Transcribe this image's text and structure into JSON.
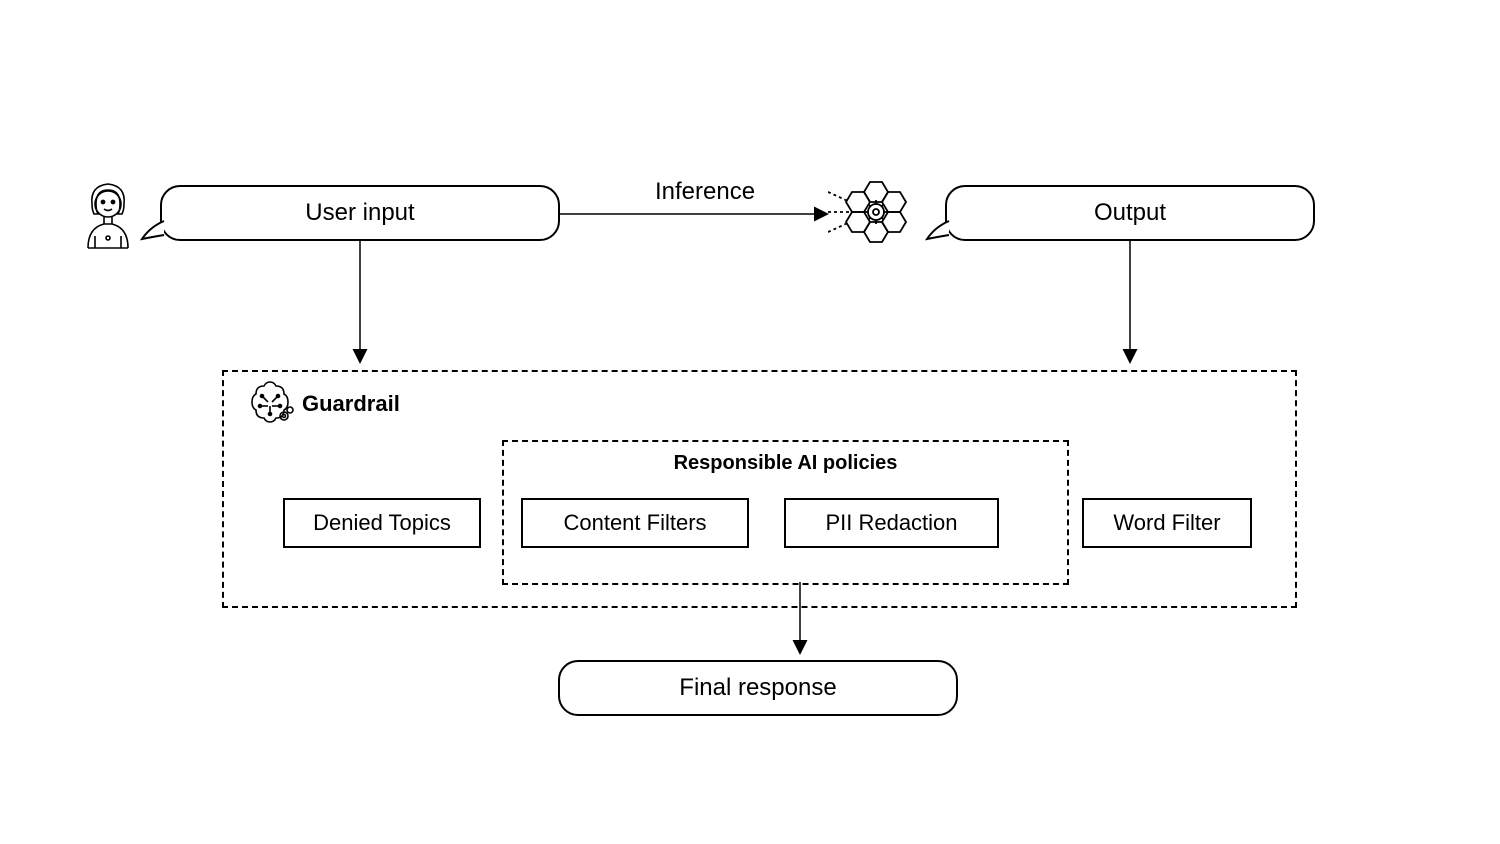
{
  "diagram": {
    "user_input_label": "User input",
    "inference_label": "Inference",
    "output_label": "Output",
    "guardrail_title": "Guardrail",
    "policies_title": "Responsible AI policies",
    "filters": {
      "denied_topics": "Denied Topics",
      "content_filters": "Content Filters",
      "pii_redaction": "PII Redaction",
      "word_filter": "Word Filter"
    },
    "final_response_label": "Final response"
  },
  "icons": {
    "user": "user-icon",
    "model": "ai-model-icon",
    "guardrail": "guardrail-icon"
  }
}
